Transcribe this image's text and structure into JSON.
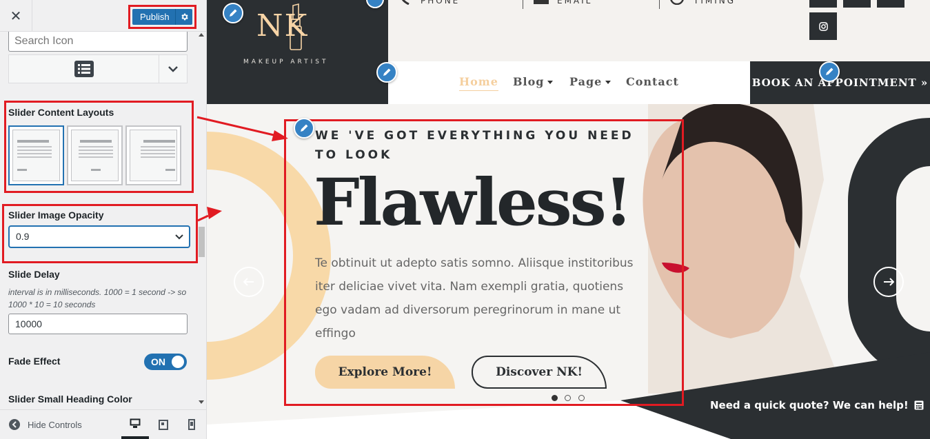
{
  "topbar": {
    "close_glyph": "✕",
    "publish_label": "Publish"
  },
  "controls": {
    "search_icon_placeholder": "Search Icon",
    "layouts_title": "Slider Content Layouts",
    "opacity_title": "Slider Image Opacity",
    "opacity_value": "0.9",
    "slide_delay_title": "Slide Delay",
    "slide_delay_desc": "interval is in milliseconds. 1000 = 1 second -> so 1000 * 10 = 10 seconds",
    "slide_delay_value": "10000",
    "fade_title": "Fade Effect",
    "fade_state": "ON",
    "small_heading_color_title": "Slider Small Heading Color"
  },
  "footer": {
    "hide_controls_label": "Hide Controls"
  },
  "site": {
    "logo_text": "NK",
    "logo_tagline": "MAKEUP ARTIST",
    "info": [
      "PHONE",
      "EMAIL",
      "TIMING"
    ],
    "nav": [
      "Home",
      "Blog",
      "Page",
      "Contact"
    ],
    "book_label": "BOOK AN APPOINTMENT »"
  },
  "hero": {
    "eyebrow": "WE 'VE GOT EVERYTHING YOU NEED TO LOOK",
    "title": "Flawless!",
    "body": "Te obtinuit ut adepto satis somno. Aliisque institoribus iter deliciae vivet vita. Nam exempli gratia, quotiens ego vadam ad diversorum peregrinorum in mane ut effingo",
    "explore_label": "Explore More!",
    "discover_label": "Discover NK!",
    "quote_label": "Need a quick quote? We can help!"
  },
  "colors": {
    "accent": "#2271b1",
    "annotation": "#e11b22",
    "brand_peach": "#f6d5a6",
    "brand_dark": "#2b2f32"
  },
  "icons": [
    "close-icon",
    "gear-icon",
    "list-icon",
    "chevron-down-icon",
    "chevron-down-icon",
    "arrow-left-icon",
    "arrow-right-icon",
    "pencil-icon",
    "instagram-icon",
    "desktop-icon",
    "tablet-icon",
    "mobile-icon",
    "calculator-icon"
  ]
}
